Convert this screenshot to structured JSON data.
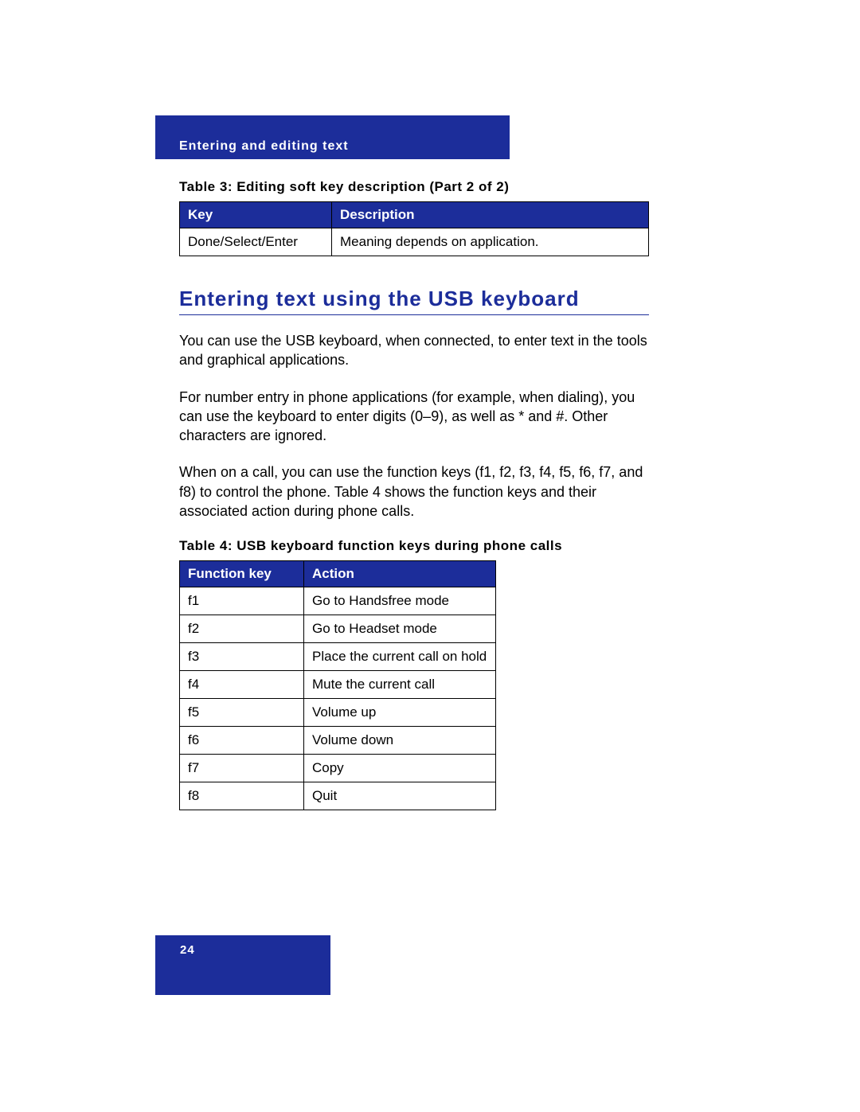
{
  "header_band": "Entering and editing text",
  "page_number": "24",
  "table3": {
    "caption": "Table 3: Editing soft key description (Part 2 of 2)",
    "head": {
      "c1": "Key",
      "c2": "Description"
    },
    "rows": [
      {
        "c1": "Done/Select/Enter",
        "c2": "Meaning depends on application."
      }
    ]
  },
  "section_heading": "Entering text using the USB keyboard",
  "paras": {
    "p1": "You can use the USB keyboard, when connected, to enter text in the tools and graphical applications.",
    "p2": "For number entry in phone applications (for example, when dialing), you can use the keyboard to enter digits (0–9), as well as * and #. Other characters are ignored.",
    "p3": "When on a call, you can use the function keys (f1, f2, f3, f4, f5, f6, f7, and f8) to control the phone. Table 4 shows the function keys and their associated action during phone calls."
  },
  "table4": {
    "caption": "Table 4: USB keyboard function keys during phone calls",
    "head": {
      "c1": "Function key",
      "c2": "Action"
    },
    "rows": [
      {
        "c1": "f1",
        "c2": "Go to Handsfree mode"
      },
      {
        "c1": "f2",
        "c2": "Go to Headset mode"
      },
      {
        "c1": "f3",
        "c2": "Place the current call on hold"
      },
      {
        "c1": "f4",
        "c2": "Mute the current call"
      },
      {
        "c1": "f5",
        "c2": "Volume up"
      },
      {
        "c1": "f6",
        "c2": "Volume down"
      },
      {
        "c1": "f7",
        "c2": "Copy"
      },
      {
        "c1": "f8",
        "c2": "Quit"
      }
    ]
  }
}
